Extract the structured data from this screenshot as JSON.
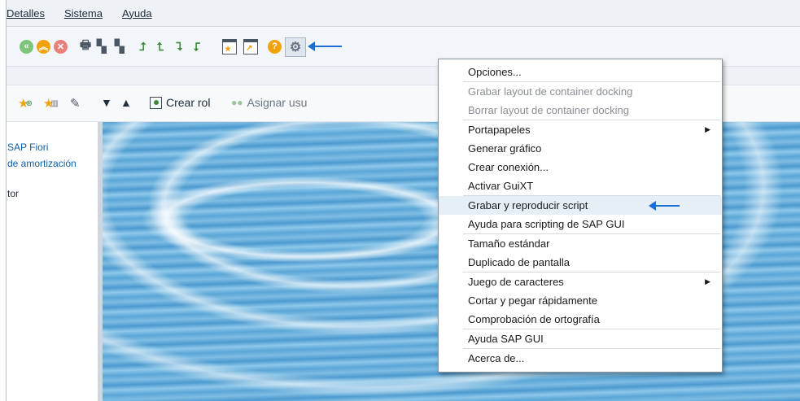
{
  "menubar": {
    "items": [
      {
        "label": "Detalles"
      },
      {
        "label": "Sistema"
      },
      {
        "label": "Ayuda"
      }
    ]
  },
  "toolbar": {
    "back_icon": "back-icon",
    "exit_icon": "exit-icon",
    "cancel_icon": "cancel-icon",
    "print_icon": "print-icon",
    "find_icon": "find-icon",
    "find_next_icon": "find-next-icon",
    "first_page_icon": "first-page-icon",
    "prev_page_icon": "previous-page-icon",
    "next_page_icon": "next-page-icon",
    "last_page_icon": "last-page-icon",
    "new_session_icon": "create-session-icon",
    "shortcut_icon": "create-shortcut-icon",
    "help_icon": "help-icon",
    "customize_icon": "customize-layout-icon"
  },
  "app_toolbar": {
    "add_favorite_icon": "add-favorite-icon",
    "delete_favorite_icon": "delete-favorite-icon",
    "edit_icon": "pencil-icon",
    "move_down_icon": "triangle-down-icon",
    "move_up_icon": "triangle-up-icon",
    "crear_rol": "Crear rol",
    "asignar": "Asignar usu"
  },
  "left_panel": {
    "line1": "SAP Fiori",
    "line2": "de amortización",
    "line3": "tor"
  },
  "menu": {
    "items": [
      {
        "label": "Opciones...",
        "disabled": false
      },
      {
        "label": "Grabar layout de container docking",
        "disabled": true
      },
      {
        "label": "Borrar layout de container docking",
        "disabled": true
      },
      {
        "label": "Portapapeles",
        "submenu": true
      },
      {
        "label": "Generar gráfico"
      },
      {
        "label": "Crear conexión..."
      },
      {
        "label": "Activar GuiXT"
      },
      {
        "label": "Grabar y reproducir script",
        "highlighted": true
      },
      {
        "label": "Ayuda para scripting de SAP GUI"
      },
      {
        "label": "Tamaño estándar"
      },
      {
        "label": "Duplicado de pantalla"
      },
      {
        "label": "Juego de caracteres",
        "submenu": true
      },
      {
        "label": "Cortar y pegar rápidamente"
      },
      {
        "label": "Comprobación de ortografía"
      },
      {
        "label": "Ayuda SAP GUI"
      },
      {
        "label": "Acerca de..."
      }
    ]
  },
  "colors": {
    "accent_arrow": "#1a6fd6",
    "link": "#0a5ea8",
    "green_icon": "#6ab04c",
    "orange_icon": "#f2a20c",
    "red_icon": "#e05a4a"
  }
}
